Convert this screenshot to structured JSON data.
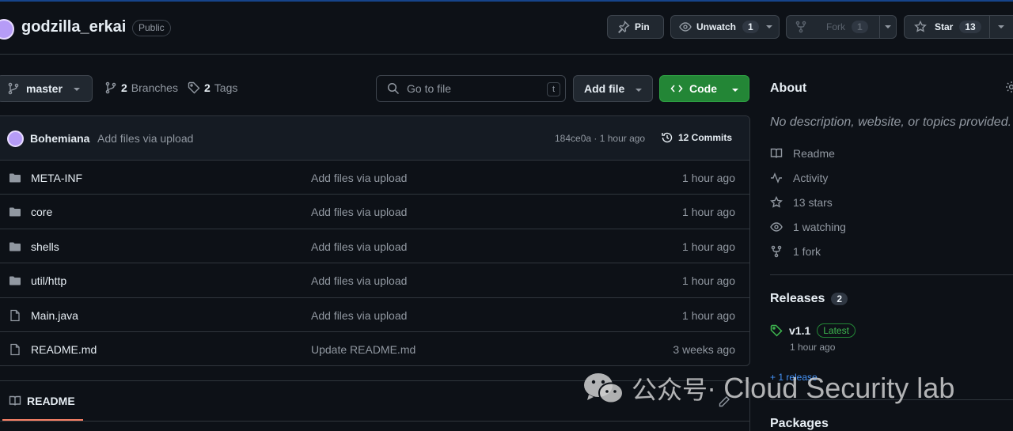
{
  "header": {
    "repo_name": "godzilla_erkai",
    "visibility": "Public",
    "pin_label": "Pin",
    "unwatch_label": "Unwatch",
    "unwatch_count": "1",
    "fork_label": "Fork",
    "fork_count": "1",
    "star_label": "Star",
    "star_count": "13"
  },
  "toolbar": {
    "branch": "master",
    "branches_count": "2",
    "branches_label": "Branches",
    "tags_count": "2",
    "tags_label": "Tags",
    "goto_placeholder": "Go to file",
    "goto_shortcut": "t",
    "add_file_label": "Add file",
    "code_label": "Code"
  },
  "latest_commit": {
    "author": "Bohemiana",
    "message": "Add files via upload",
    "hash_time": "184ce0a · 1 hour ago",
    "commits_label": "12 Commits"
  },
  "files": [
    {
      "type": "folder",
      "name": "META-INF",
      "message": "Add files via upload",
      "time": "1 hour ago"
    },
    {
      "type": "folder",
      "name": "core",
      "message": "Add files via upload",
      "time": "1 hour ago"
    },
    {
      "type": "folder",
      "name": "shells",
      "message": "Add files via upload",
      "time": "1 hour ago"
    },
    {
      "type": "folder",
      "name": "util/http",
      "message": "Add files via upload",
      "time": "1 hour ago"
    },
    {
      "type": "file",
      "name": "Main.java",
      "message": "Add files via upload",
      "time": "1 hour ago"
    },
    {
      "type": "file",
      "name": "README.md",
      "message": "Update README.md",
      "time": "3 weeks ago"
    }
  ],
  "readme": {
    "tab_label": "README"
  },
  "sidebar": {
    "about_title": "About",
    "description": "No description, website, or topics provided.",
    "items": [
      {
        "icon": "book-icon",
        "label": "Readme"
      },
      {
        "icon": "pulse-icon",
        "label": "Activity"
      },
      {
        "icon": "star-icon",
        "label": "13 stars"
      },
      {
        "icon": "eye-icon",
        "label": "1 watching"
      },
      {
        "icon": "fork-icon",
        "label": "1 fork"
      }
    ],
    "releases_title": "Releases",
    "releases_count": "2",
    "release_tag": "v1.1",
    "release_badge": "Latest",
    "release_time": "1 hour ago",
    "more_releases": "+ 1 release",
    "packages_title": "Packages"
  },
  "watermark": {
    "cn_text": "公众号·",
    "en_text": "Cloud Security lab"
  },
  "colors": {
    "background": "#0d1117",
    "border": "#30363d",
    "code_button": "#238636",
    "link": "#4493f8",
    "latest": "#3fb950",
    "tab_underline": "#f78166"
  }
}
